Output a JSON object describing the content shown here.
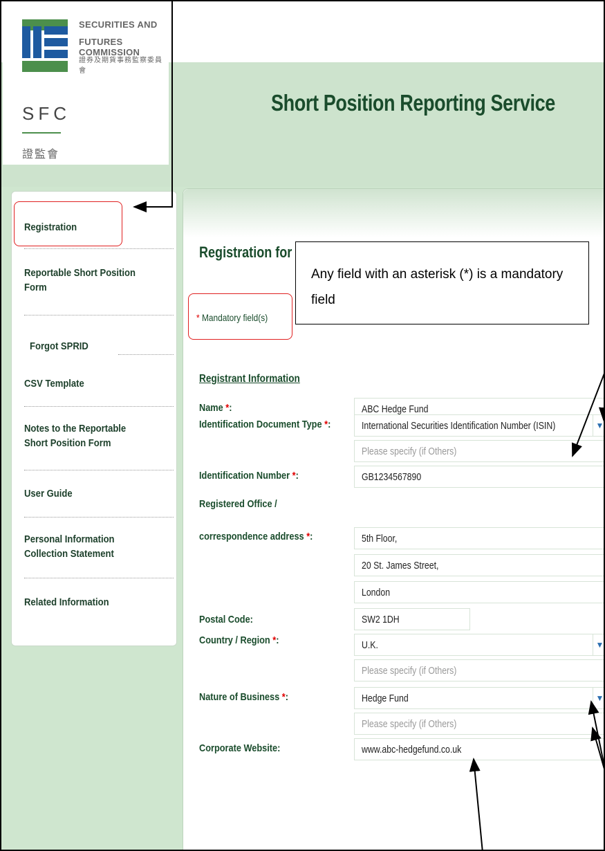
{
  "logo": {
    "org_line1": "SECURITIES AND",
    "org_line2": "FUTURES COMMISSION",
    "org_chinese": "證券及期貨事務監察委員會",
    "abbr": "SFC",
    "abbr_chinese": "證監會"
  },
  "header": {
    "title": "Short Position Reporting Service"
  },
  "sidebar": {
    "items": [
      {
        "label": "Registration"
      },
      {
        "label": "Reportable Short Position Form"
      },
      {
        "label": "Forgot SPRID"
      },
      {
        "label": "CSV Template"
      },
      {
        "label": "Notes to the Reportable Short Position Form"
      },
      {
        "label": "User Guide"
      },
      {
        "label": "Personal Information Collection Statement"
      },
      {
        "label": "Related Information"
      }
    ]
  },
  "main": {
    "heading": "Registration for",
    "mandatory_note": "Mandatory field(s)",
    "asterisk": "*",
    "section_title": "Registrant Information"
  },
  "callout": {
    "text": "Any field with an asterisk (*) is a mandatory field"
  },
  "form": {
    "name_label": "Name",
    "name_value": "ABC Hedge Fund",
    "id_type_label": "Identification Document Type",
    "id_type_value": "International Securities Identification Number (ISIN)",
    "id_type_specify_placeholder": "Please specify (if Others)",
    "id_number_label": "Identification Number",
    "id_number_value": "GB1234567890",
    "address_label_line1": "Registered Office /",
    "address_label_line2": "correspondence address",
    "address_line1": "5th Floor,",
    "address_line2": "20 St. James Street,",
    "address_line3": "London",
    "postal_label": "Postal Code:",
    "postal_value": "SW2 1DH",
    "country_label": "Country / Region",
    "country_value": "U.K.",
    "country_specify_placeholder": "Please specify (if Others)",
    "business_label": "Nature of Business",
    "business_value": "Hedge Fund",
    "business_specify_placeholder": "Please specify (if Others)",
    "website_label": "Corporate Website:",
    "website_value": "www.abc-hedgefund.co.uk",
    "colon": ":"
  },
  "colors": {
    "brand_green": "#1a4c2c",
    "page_green": "#cfe6cf",
    "logo_blue": "#1e5aa0",
    "required_red": "#e00000",
    "highlight_red": "#e02020"
  }
}
